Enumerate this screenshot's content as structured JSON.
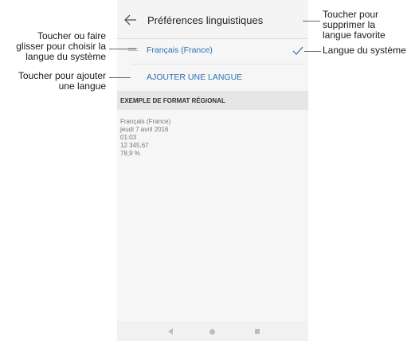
{
  "screen": {
    "title": "Préférences linguistiques",
    "back_icon": "arrow-left-icon",
    "languages": [
      {
        "label": "Français (France)",
        "selected": true
      }
    ],
    "add_language": "AJOUTER UNE LANGUE",
    "section_title": "EXEMPLE DE FORMAT RÉGIONAL",
    "examples": [
      "Français (France)",
      "jeudi 7 avril 2016",
      "01:03",
      "12 345,67",
      "78,9 %"
    ],
    "accent_color": "#2e6fb5",
    "nav_icons": [
      "nav-back-icon",
      "nav-home-icon",
      "nav-recent-icon"
    ]
  },
  "annotations": {
    "drag": [
      "Toucher ou faire",
      "glisser pour choisir la",
      "langue du système"
    ],
    "add": [
      "Toucher pour ajouter",
      "une langue"
    ],
    "remove": [
      "Toucher pour",
      "supprimer la",
      "langue favorite"
    ],
    "system": "Langue du système"
  }
}
